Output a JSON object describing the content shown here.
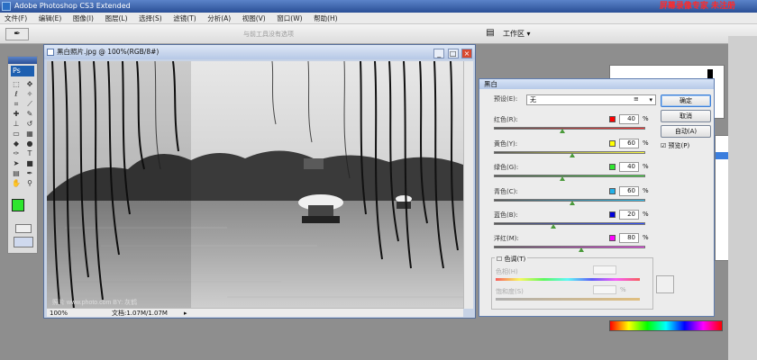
{
  "app": {
    "title": "Adobe Photoshop CS3 Extended",
    "watermark": "屏幕录像专家 未注册"
  },
  "menu": [
    "文件(F)",
    "编辑(E)",
    "图像(I)",
    "图层(L)",
    "选择(S)",
    "滤镜(T)",
    "分析(A)",
    "视图(V)",
    "窗口(W)",
    "帮助(H)"
  ],
  "options_bar": {
    "tool_icon": "eyedropper-icon",
    "hint": "与前工具没有选项",
    "workspace_label": "工作区 ▾"
  },
  "toolbox": {
    "logo": "Ps",
    "foreground_color": "#2ee62e",
    "background_color": "#000000"
  },
  "document": {
    "title": "黑白照片.jpg @ 100%(RGB/8#)",
    "zoom": "100%",
    "doc_size": "文档:1.07M/1.07M",
    "image_watermark": "照片 www.photo.com     BY: 灰鹤"
  },
  "dialog": {
    "title": "黑白",
    "preset_label": "预设(E):",
    "preset_value": "无",
    "buttons": {
      "ok": "确定",
      "cancel": "取消",
      "auto": "自动(A)",
      "preview": "预览(P)"
    },
    "sliders": [
      {
        "label": "红色(R):",
        "value": "40",
        "unit": "%",
        "color": "#ff0000",
        "level": 0.45
      },
      {
        "label": "黄色(Y):",
        "value": "60",
        "unit": "%",
        "color": "#ffff00",
        "level": 0.52
      },
      {
        "label": "绿色(G):",
        "value": "40",
        "unit": "%",
        "color": "#2ee62e",
        "level": 0.45
      },
      {
        "label": "青色(C):",
        "value": "60",
        "unit": "%",
        "color": "#22b0e8",
        "level": 0.52
      },
      {
        "label": "蓝色(B):",
        "value": "20",
        "unit": "%",
        "color": "#0000dd",
        "level": 0.39
      },
      {
        "label": "洋红(M):",
        "value": "80",
        "unit": "%",
        "color": "#ff00ff",
        "level": 0.58
      }
    ],
    "tint": {
      "label": "色调(T)",
      "hue_label": "色相(H)",
      "saturation_label": "饱和度(S)",
      "saturation_unit": "%"
    }
  }
}
